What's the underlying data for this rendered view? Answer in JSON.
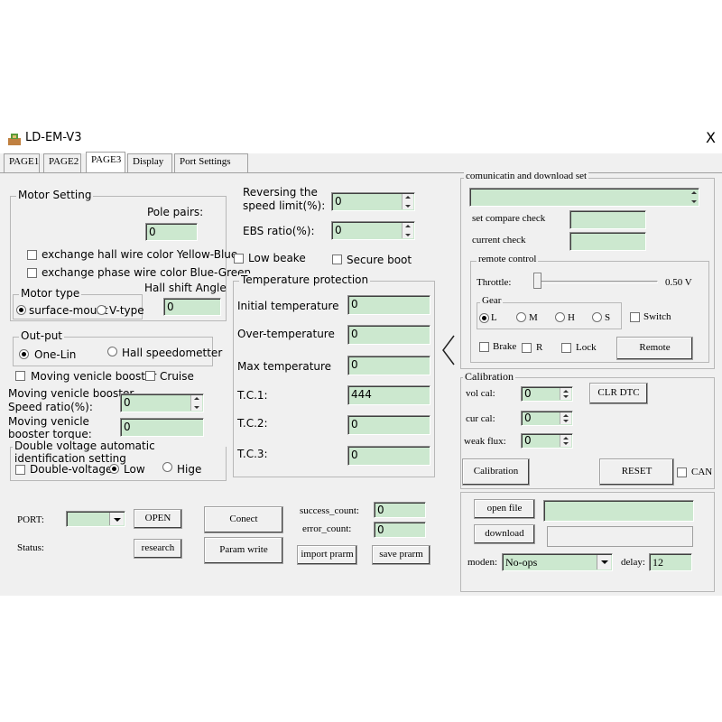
{
  "window": {
    "title": "LD-EM-V3",
    "close": "X"
  },
  "tabs": [
    "PAGE1",
    "PAGE2",
    "PAGE3",
    "Display",
    "Port Settings"
  ],
  "motor_setting": {
    "group_label": "Motor Setting",
    "pole_pairs_label": "Pole pairs:",
    "pole_pairs_value": "0",
    "hall_color": "exchange hall wire color Yellow-Blue",
    "phase_color": "exchange phase wire color Blue-Green",
    "hall_shift_label": "Hall shift Angle",
    "hall_shift_value": "0",
    "motor_type_label": "Motor type",
    "surface_mount": "surface-mount",
    "v_type": "V-type"
  },
  "reversing": {
    "label1": "Reversing the",
    "label2": "speed limit(%):",
    "value": "0"
  },
  "ebs": {
    "label": "EBS ratio(%):",
    "value": "0"
  },
  "low_beake": "Low beake",
  "secure_boot": "Secure boot",
  "output": {
    "group_label": "Out-put",
    "one_lin": "One-Lin",
    "hall_speedometer": "Hall speedometter"
  },
  "booster": {
    "moving_booster": "Moving venicle booster",
    "cruise": "Cruise",
    "speed_label1": "Moving venicle booster",
    "speed_label2": "Speed ratio(%):",
    "speed_value": "0",
    "torque_label1": "Moving venicle",
    "torque_label2": "booster torque:",
    "torque_value": "0"
  },
  "double_voltage": {
    "group_label": "Double voltage automatic identification setting",
    "dv": "Double-voltage",
    "low": "Low",
    "high": "Hige"
  },
  "temperature": {
    "group_label": "Temperature protection",
    "rows": [
      {
        "label": "Initial temperature",
        "value": "0"
      },
      {
        "label": "Over-temperature",
        "value": "0"
      },
      {
        "label": "Max temperature",
        "value": "0"
      },
      {
        "label": "T.C.1:",
        "value": "444"
      },
      {
        "label": "T.C.2:",
        "value": "0"
      },
      {
        "label": "T.C.3:",
        "value": "0"
      }
    ]
  },
  "port": {
    "port_label": "PORT:",
    "open": "OPEN",
    "status_label": "Status:",
    "research": "research",
    "connect": "Conect",
    "param_write": "Param write",
    "success_label": "success_count:",
    "success_value": "0",
    "error_label": "error_count:",
    "error_value": "0",
    "import": "import prarm",
    "save": "save prarm"
  },
  "comm": {
    "group_label": "comunicatin and download set",
    "set_compare": "set compare check",
    "current_check": "current check",
    "remote_label": "remote control",
    "throttle_label": "Throttle:",
    "throttle_value": "0.50 V",
    "throttle_level": 0.0,
    "gear_label": "Gear",
    "gears": [
      "L",
      "M",
      "H",
      "S"
    ],
    "switch": "Switch",
    "brake": "Brake",
    "r": "R",
    "lock": "Lock",
    "remote_btn": "Remote"
  },
  "calibration": {
    "group_label": "Calibration",
    "vol_cal": "vol cal:",
    "vol_value": "0",
    "cur_cal": "cur cal:",
    "cur_value": "0",
    "weak_flux": "weak flux:",
    "weak_value": "0",
    "clr_dtc": "CLR DTC",
    "calibration_btn": "Calibration",
    "reset": "RESET",
    "can": "CAN"
  },
  "download": {
    "open_file": "open file",
    "download_btn": "download",
    "moden_label": "moden:",
    "moden_value": "No-ops",
    "delay_label": "delay:",
    "delay_value": "12"
  }
}
